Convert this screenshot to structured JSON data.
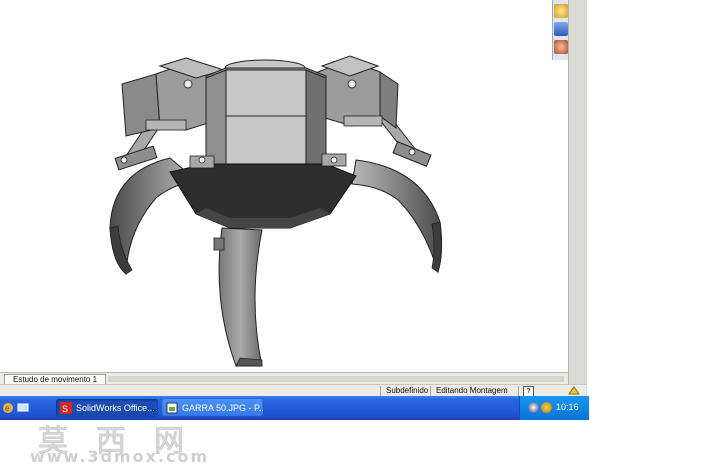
{
  "viewport": {
    "model_description_icon": "robotic-gripper-claw-model"
  },
  "taskpane": {
    "icons": [
      "house-icon",
      "library-icon",
      "palette-icon"
    ]
  },
  "tabs": [
    {
      "label": "Estudo de movimento 1"
    }
  ],
  "statusbar": {
    "state": "Subdefinido",
    "mode": "Editando Montagem",
    "help": "?"
  },
  "taskbar": {
    "quicklaunch": [
      "ie-icon",
      "desktop-icon"
    ],
    "buttons": [
      {
        "label": "SolidWorks Office...",
        "icon": "solidworks-icon",
        "active": true
      },
      {
        "label": "GARRA 50.JPG - P...",
        "icon": "image-file-icon",
        "active": false
      }
    ],
    "clock": "10:16"
  },
  "watermark": {
    "chars": "莫西网",
    "url": "www.3dmox.com"
  }
}
